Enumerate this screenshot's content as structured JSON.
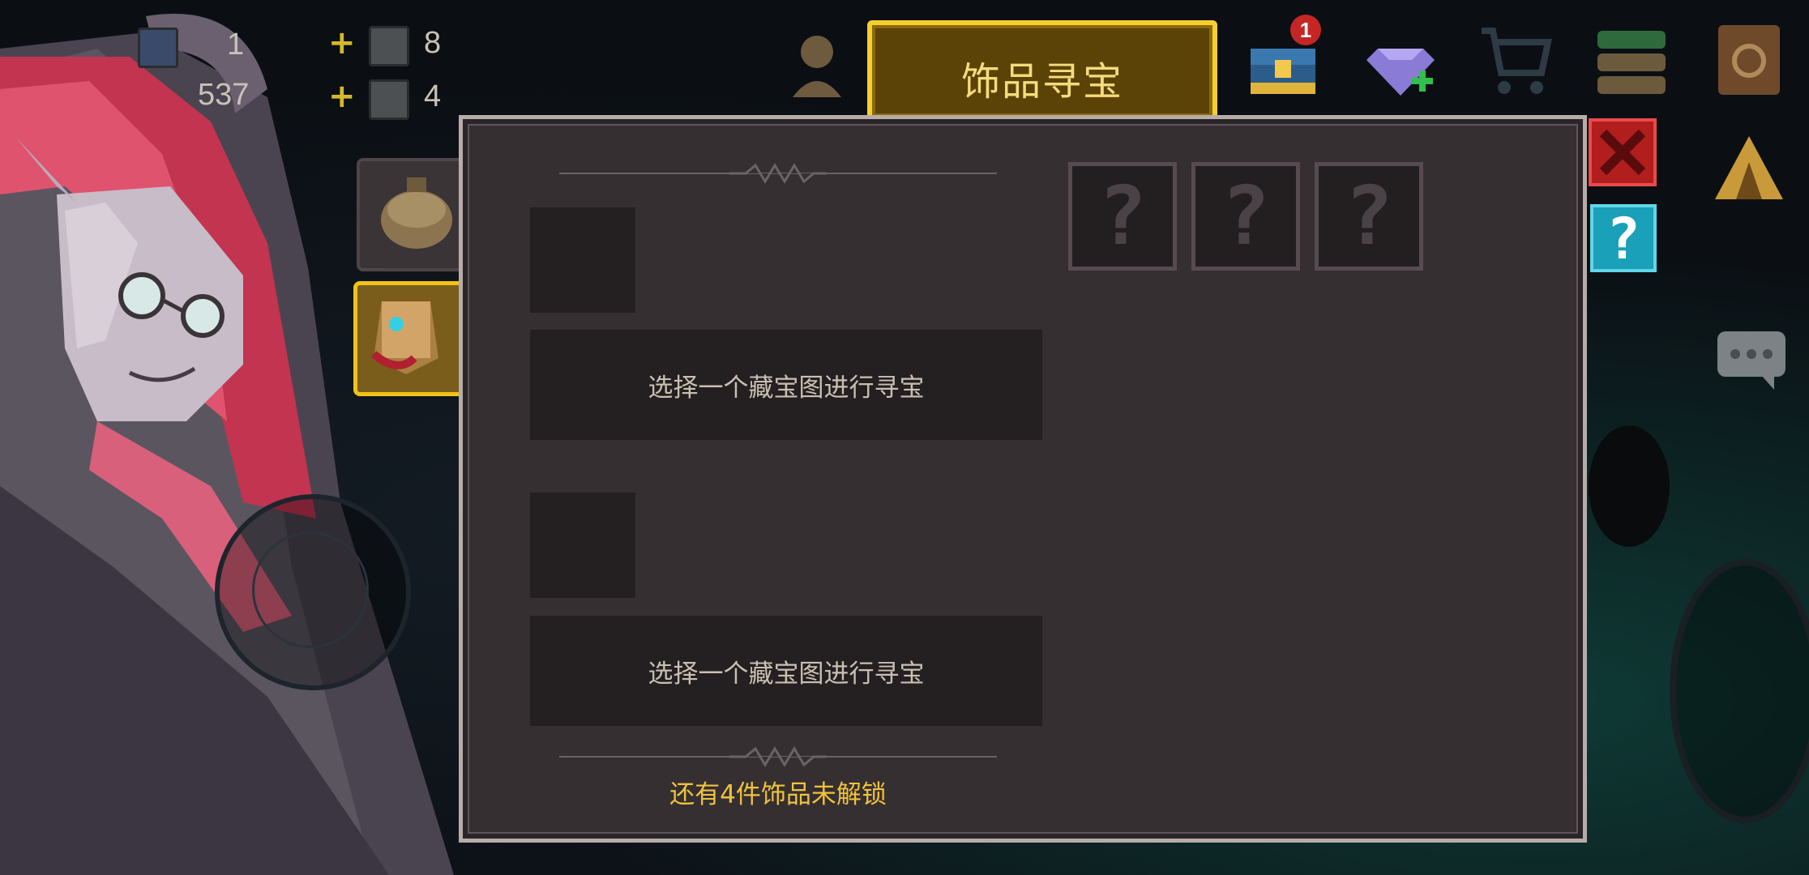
{
  "hud": {
    "resource_1_value": "1",
    "resource_2_value": "537",
    "material_1_count": "8",
    "material_2_count": "4"
  },
  "header": {
    "title": "饰品寻宝",
    "chest_badge": "1"
  },
  "treasure": {
    "slot_1_prompt": "选择一个藏宝图进行寻宝",
    "slot_2_prompt": "选择一个藏宝图进行寻宝",
    "unknown_rewards": [
      "?",
      "?",
      "?"
    ],
    "locked_message": "还有4件饰品未解锁"
  },
  "controls": {
    "help_label": "?"
  },
  "colors": {
    "panel_bg": "#352f32",
    "title_tab_border": "#f5cf2e",
    "footer_text": "#f0c23c",
    "close_button": "#b21d1d",
    "help_button": "#1aa0b8"
  },
  "icons": [
    "character-portrait-icon",
    "treasure-chest-icon",
    "gem-add-icon",
    "shop-cart-icon",
    "menu-stack-icon",
    "book-icon",
    "close-icon",
    "help-icon",
    "chat-icon",
    "backpack-icon",
    "treasure-map-icon",
    "tent-icon"
  ]
}
